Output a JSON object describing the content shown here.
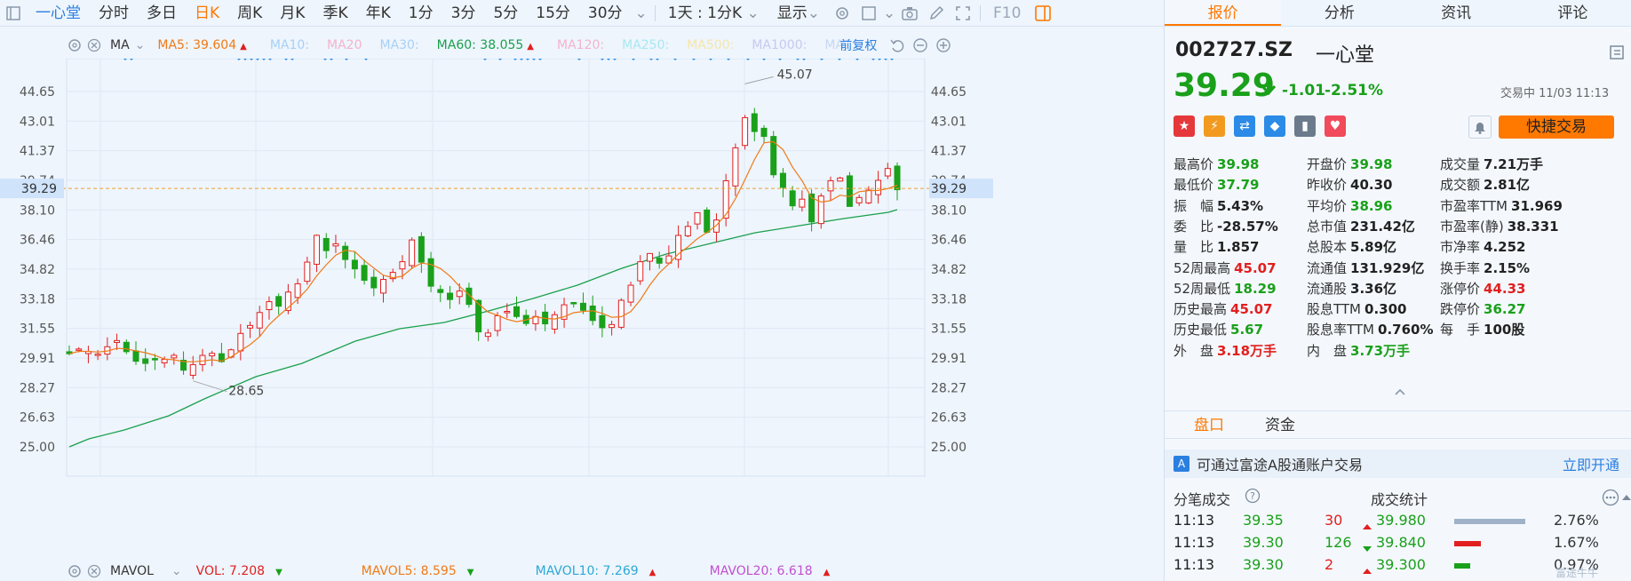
{
  "toolbar": {
    "stock_name": "一心堂",
    "tabs": [
      "分时",
      "多日",
      "日K",
      "周K",
      "月K",
      "季K",
      "年K",
      "1分",
      "3分",
      "5分",
      "15分",
      "30分"
    ],
    "active_tab": "日K",
    "chevron": "⌄",
    "mode_select": "1天 : 1分K",
    "display_label": "显示",
    "f10_label": "F10"
  },
  "ma_bar": {
    "indicator": "MA",
    "items": [
      {
        "label": "MA5: 39.604",
        "color": "#f07a16",
        "arrow": "▲",
        "arrow_color": "#e21f1f"
      },
      {
        "label": "MA10:",
        "color": "#a8d0f5"
      },
      {
        "label": "MA20",
        "color": "#f5b3cf"
      },
      {
        "label": "MA30:",
        "color": "#a8d0f5"
      },
      {
        "label": "MA60: 38.055",
        "color": "#1aa04c",
        "arrow": "▲",
        "arrow_color": "#e21f1f"
      },
      {
        "label": "MA120:",
        "color": "#f5b3cf"
      },
      {
        "label": "MA250:",
        "color": "#a8e8f0"
      },
      {
        "label": "MA500:",
        "color": "#f5e6a8"
      },
      {
        "label": "MA1000:",
        "color": "#c8c8f0"
      },
      {
        "label": "MA1:",
        "color": "#c8d8f0"
      }
    ],
    "adjust": "前复权"
  },
  "vol_bar": {
    "indicator": "MAVOL",
    "items": [
      {
        "label": "VOL: 7.208",
        "color": "#e21f1f",
        "arrow": "▼",
        "arrow_color": "#1aa01a"
      },
      {
        "label": "MAVOL5: 8.595",
        "color": "#f07a16",
        "arrow": "▼",
        "arrow_color": "#1aa01a"
      },
      {
        "label": "MAVOL10: 7.269",
        "color": "#2ba9d6",
        "arrow": "▲",
        "arrow_color": "#e21f1f"
      },
      {
        "label": "MAVOL20: 6.618",
        "color": "#c24fd0",
        "arrow": "▲",
        "arrow_color": "#e21f1f"
      }
    ]
  },
  "chart_data": {
    "type": "candlestick",
    "y_ticks": [
      "44.65",
      "43.01",
      "41.37",
      "39.74",
      "38.10",
      "36.46",
      "34.82",
      "33.18",
      "31.55",
      "29.91",
      "28.27",
      "26.63",
      "25.00"
    ],
    "current_price_label": "39.29",
    "current_price": 39.29,
    "high_annotation": "45.07",
    "low_annotation": "28.65",
    "ylim": [
      25.0,
      44.65
    ],
    "colors": {
      "up": "#e21f1f",
      "down": "#1aa01a",
      "ma5": "#f07a16",
      "ma60": "#1aa04c",
      "current": "#f0a030"
    }
  },
  "right_panel": {
    "tabs": [
      "报价",
      "分析",
      "资讯",
      "评论"
    ],
    "active_tab": "报价",
    "code": "002727.SZ",
    "name": "一心堂",
    "price": "39.29",
    "change": "-1.01",
    "change_pct": "-2.51%",
    "status_time": "交易中 11/03 11:13",
    "quick_trade": "快捷交易",
    "quotes": [
      [
        {
          "k": "最高价",
          "v": "39.98",
          "c": "green"
        },
        {
          "k": "开盘价",
          "v": "39.98",
          "c": "green"
        },
        {
          "k": "成交量",
          "v": "7.21万手",
          "c": "dark"
        }
      ],
      [
        {
          "k": "最低价",
          "v": "37.79",
          "c": "green"
        },
        {
          "k": "昨收价",
          "v": "40.30",
          "c": "dark"
        },
        {
          "k": "成交额",
          "v": "2.81亿",
          "c": "dark"
        }
      ],
      [
        {
          "k": "振　幅",
          "v": "5.43%",
          "c": "dark"
        },
        {
          "k": "平均价",
          "v": "38.96",
          "c": "green"
        },
        {
          "k": "市盈率TTM",
          "v": "31.969",
          "c": "dark"
        }
      ],
      [
        {
          "k": "委　比",
          "v": "-28.57%",
          "c": "dark"
        },
        {
          "k": "总市值",
          "v": "231.42亿",
          "c": "dark"
        },
        {
          "k": "市盈率(静)",
          "v": "38.331",
          "c": "dark"
        }
      ],
      [
        {
          "k": "量　比",
          "v": "1.857",
          "c": "dark"
        },
        {
          "k": "总股本",
          "v": "5.89亿",
          "c": "dark"
        },
        {
          "k": "市净率",
          "v": "4.252",
          "c": "dark"
        }
      ],
      [
        {
          "k": "52周最高",
          "v": "45.07",
          "c": "red"
        },
        {
          "k": "流通值",
          "v": "131.929亿",
          "c": "dark"
        },
        {
          "k": "换手率",
          "v": "2.15%",
          "c": "dark"
        }
      ],
      [
        {
          "k": "52周最低",
          "v": "18.29",
          "c": "green"
        },
        {
          "k": "流通股",
          "v": "3.36亿",
          "c": "dark"
        },
        {
          "k": "涨停价",
          "v": "44.33",
          "c": "red"
        }
      ],
      [
        {
          "k": "历史最高",
          "v": "45.07",
          "c": "red"
        },
        {
          "k": "股息TTM",
          "v": "0.300",
          "c": "dark"
        },
        {
          "k": "跌停价",
          "v": "36.27",
          "c": "green"
        }
      ],
      [
        {
          "k": "历史最低",
          "v": "5.67",
          "c": "green"
        },
        {
          "k": "股息率TTM",
          "v": "0.760%",
          "c": "dark"
        },
        {
          "k": "每　手",
          "v": "100股",
          "c": "dark"
        }
      ],
      [
        {
          "k": "外　盘",
          "v": "3.18万手",
          "c": "red"
        },
        {
          "k": "内　盘",
          "v": "3.73万手",
          "c": "green"
        }
      ]
    ],
    "subtabs": [
      "盘口",
      "资金"
    ],
    "active_subtab": "盘口",
    "ad_text": "可通过富途A股通账户交易",
    "ad_link": "立即开通",
    "ticks_title": "分笔成交",
    "stats_title": "成交统计",
    "ticks": [
      {
        "time": "11:13",
        "price": "39.35",
        "vol": "30",
        "dir": "up"
      },
      {
        "time": "11:13",
        "price": "39.30",
        "vol": "126",
        "dir": "down"
      },
      {
        "time": "11:13",
        "price": "39.30",
        "vol": "2",
        "dir": "up"
      }
    ],
    "stats": [
      {
        "price": "39.980",
        "pct": "2.76%",
        "bar_color": "#9fb2c8"
      },
      {
        "price": "39.840",
        "pct": "1.67%",
        "bar_color": "#e21f1f"
      },
      {
        "price": "39.300",
        "pct": "0.97%",
        "bar_color": "#1aa01a"
      }
    ],
    "watermark": "富途牛牛"
  }
}
